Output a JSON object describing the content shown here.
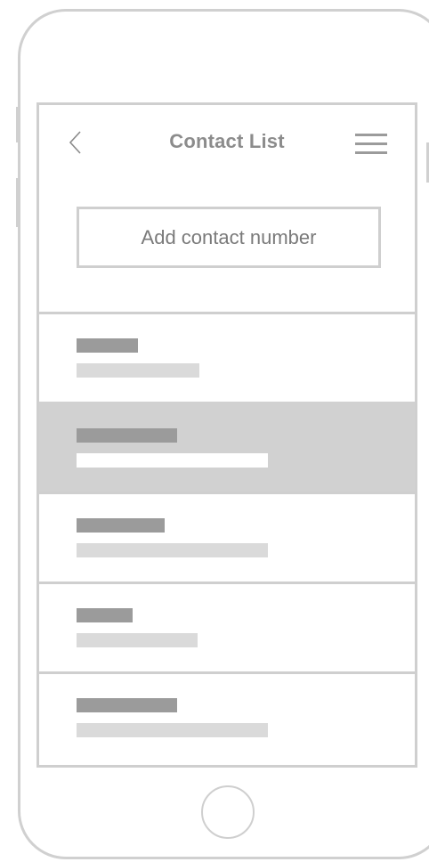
{
  "header": {
    "title": "Contact List",
    "back_icon": "chevron-left-icon",
    "menu_icon": "hamburger-menu-icon"
  },
  "add_button": {
    "label": "Add contact number"
  },
  "contacts": {
    "selected_index": 1,
    "rows": [
      {
        "name": "",
        "number": ""
      },
      {
        "name": "",
        "number": ""
      },
      {
        "name": "",
        "number": ""
      },
      {
        "name": "",
        "number": ""
      },
      {
        "name": "",
        "number": ""
      }
    ]
  },
  "colors": {
    "frame": "#d0d0d0",
    "text": "#8c8c8c",
    "placeholder_dark": "#9b9b9b",
    "placeholder_light": "#dadada",
    "selected_row": "#d1d1d1"
  }
}
